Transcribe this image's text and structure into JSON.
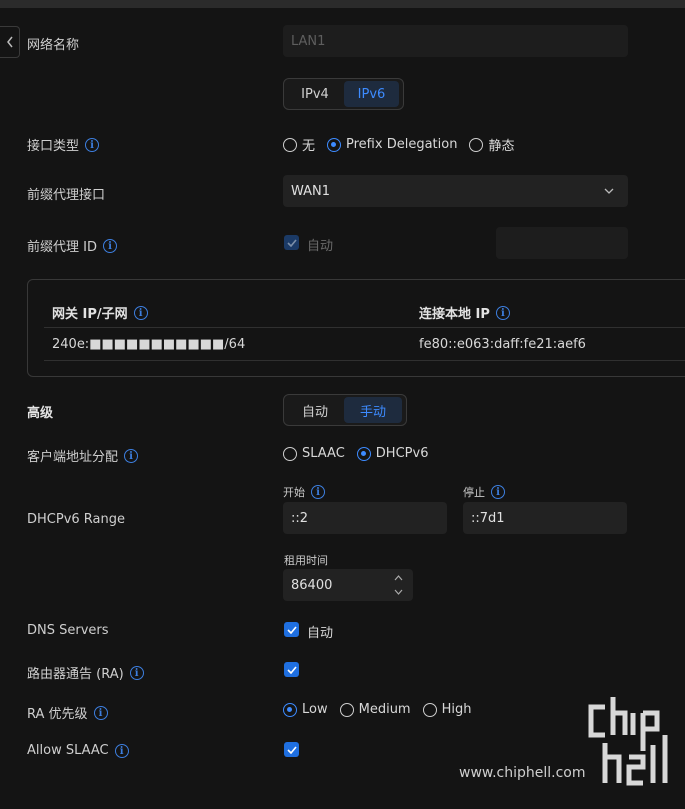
{
  "network_name": {
    "label": "网络名称",
    "value": "LAN1"
  },
  "ip_version_tabs": [
    "IPv4",
    "IPv6"
  ],
  "interface_type": {
    "label": "接口类型",
    "options": [
      "无",
      "Prefix Delegation",
      "静态"
    ],
    "selected": "Prefix Delegation"
  },
  "prefix_interface": {
    "label": "前缀代理接口",
    "value": "WAN1"
  },
  "prefix_id": {
    "label": "前缀代理 ID",
    "auto_label": "自动",
    "checked": true
  },
  "address_table": {
    "headers": [
      "网关 IP/子网",
      "连接本地 IP"
    ],
    "rows": [
      [
        "240e:■■■■■■■■■■■/64",
        "fe80::e063:daff:fe21:aef6"
      ]
    ]
  },
  "advanced": {
    "label": "高级",
    "tabs": [
      "自动",
      "手动"
    ],
    "selected": "手动"
  },
  "client_address": {
    "label": "客户端地址分配",
    "options": [
      "SLAAC",
      "DHCPv6"
    ],
    "selected": "DHCPv6"
  },
  "dhcpv6_range": {
    "label": "DHCPv6 Range",
    "start_label": "开始",
    "start": "::2",
    "stop_label": "停止",
    "stop": "::7d1"
  },
  "lease": {
    "label": "租用时间",
    "value": "86400"
  },
  "dns_servers": {
    "label": "DNS Servers",
    "auto_label": "自动",
    "checked": true
  },
  "ra": {
    "label": "路由器通告 (RA)",
    "checked": true
  },
  "ra_priority": {
    "label": "RA 优先级",
    "options": [
      "Low",
      "Medium",
      "High"
    ],
    "selected": "Low"
  },
  "allow_slaac": {
    "label": "Allow SLAAC",
    "checked": true
  },
  "watermark": "www.chiphell.com",
  "colors": {
    "accent": "#3d8bff",
    "background": "#141414",
    "input": "#222222"
  }
}
